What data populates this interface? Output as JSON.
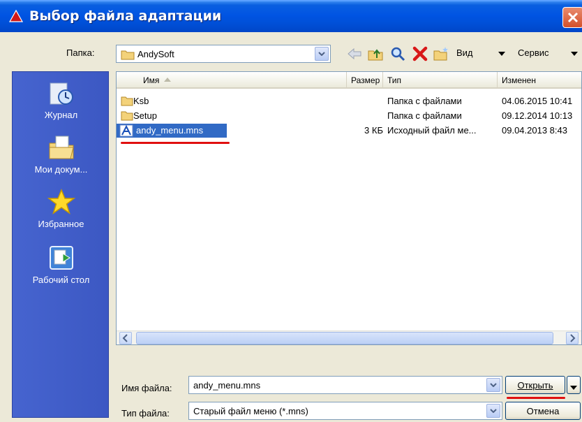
{
  "window": {
    "title": "Выбор файла адаптации"
  },
  "folder": {
    "label": "Папка:",
    "value": "AndySoft"
  },
  "toolbar": {
    "view_label": "Вид",
    "tools_label": "Сервис"
  },
  "places": [
    {
      "label": "Журнал",
      "icon": "history-icon"
    },
    {
      "label": "Мои докум...",
      "icon": "my-documents-icon"
    },
    {
      "label": "Избранное",
      "icon": "favorites-star-icon"
    },
    {
      "label": "Рабочий стол",
      "icon": "desktop-icon"
    }
  ],
  "columns": {
    "name": "Имя",
    "size": "Размер",
    "type": "Тип",
    "modified": "Изменен"
  },
  "files": [
    {
      "name": "Ksb",
      "size": "",
      "type": "Папка с файлами",
      "modified": "04.06.2015 10:41",
      "icon": "folder-icon"
    },
    {
      "name": "Setup",
      "size": "",
      "type": "Папка с файлами",
      "modified": "09.12.2014 10:13",
      "icon": "folder-icon"
    },
    {
      "name": "andy_menu.mns",
      "size": "3 КБ",
      "type": "Исходный файл ме...",
      "modified": "09.04.2013 8:43",
      "icon": "menu-source-file-icon"
    }
  ],
  "filename": {
    "label": "Имя файла:",
    "value": "andy_menu.mns"
  },
  "filetype": {
    "label": "Тип файла:",
    "value": "Старый файл меню (*.mns)"
  },
  "buttons": {
    "open": "Открыть",
    "cancel": "Отмена"
  },
  "colors": {
    "title_bar": "#0054e3",
    "places_bar": "#4664cf",
    "selection": "#316ac5",
    "annotation": "#e01010"
  }
}
